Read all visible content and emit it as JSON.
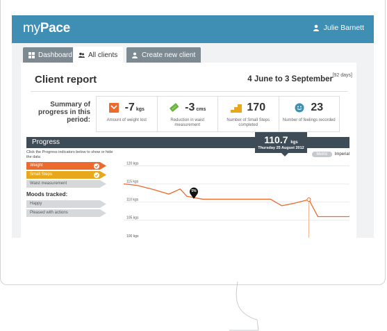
{
  "app": {
    "brand_prefix": "my",
    "brand_name": "Pace",
    "user_name": "Julie Barnett"
  },
  "tabs": [
    {
      "label": "Dashboard",
      "icon": "grid-icon",
      "active": false
    },
    {
      "label": "All clients",
      "icon": "users-icon",
      "active": true
    },
    {
      "label": "Create new client",
      "icon": "add-user-icon",
      "active": false
    }
  ],
  "report": {
    "title": "Client report",
    "dates": "4 June to 3 September",
    "days": "[92 days]"
  },
  "summary": {
    "label": "Summary of progress in this period:",
    "stats": [
      {
        "icon": "scale-icon",
        "value": "-7",
        "unit": "kgs",
        "caption": "Amount of weight lost",
        "color": "#ec6a2c"
      },
      {
        "icon": "tape-measure-icon",
        "value": "-3",
        "unit": "cms",
        "caption": "Reduction in waist measurement",
        "color": "#6ab43e"
      },
      {
        "icon": "steps-icon",
        "value": "170",
        "unit": "",
        "caption": "Number of Small Steps completed",
        "color": "#e8a81c"
      },
      {
        "icon": "smiley-icon",
        "value": "23",
        "unit": "",
        "caption": "Number of feelings recorded",
        "color": "#3e8fb3"
      }
    ]
  },
  "progress": {
    "title": "Progress",
    "hint": "Click the Progress indicators below to show or hide the data",
    "indicators": [
      {
        "label": "Weight",
        "style": "orange",
        "checked": true
      },
      {
        "label": "Small Steps",
        "style": "yellow",
        "checked": true
      },
      {
        "label": "Waist measurement",
        "style": "grey",
        "checked": false
      }
    ],
    "moods_label": "Moods tracked:",
    "moods": [
      "Happy",
      "Pleased with actions"
    ],
    "units": {
      "metric": "Metric",
      "imperial": "Imperial"
    }
  },
  "tooltip": {
    "value": "110.7",
    "unit": "kgs",
    "date": "Thursday 25 August 2012"
  },
  "marker": {
    "label": "5%"
  },
  "chart_data": {
    "type": "line",
    "ylabel": "",
    "y_tick_labels": [
      "120 kgs",
      "115 kgs",
      "110 kgs",
      "105 kgs",
      "100 kgs"
    ],
    "y_ticks": [
      120,
      115,
      110,
      105,
      100
    ],
    "ylim": [
      99,
      122
    ],
    "grid": true,
    "series": [
      {
        "color": "#ec6a2c",
        "x": [
          0,
          6,
          13,
          20,
          25,
          28,
          35,
          45,
          55,
          65,
          70,
          75,
          82,
          86,
          90,
          100
        ],
        "values": [
          115,
          114.6,
          113.5,
          112.2,
          113.6,
          111.6,
          110.8,
          110.8,
          110.8,
          110.8,
          109,
          109.6,
          110.7,
          106,
          106,
          106
        ]
      }
    ],
    "highlight": {
      "x": 82,
      "value": 110.7
    }
  }
}
